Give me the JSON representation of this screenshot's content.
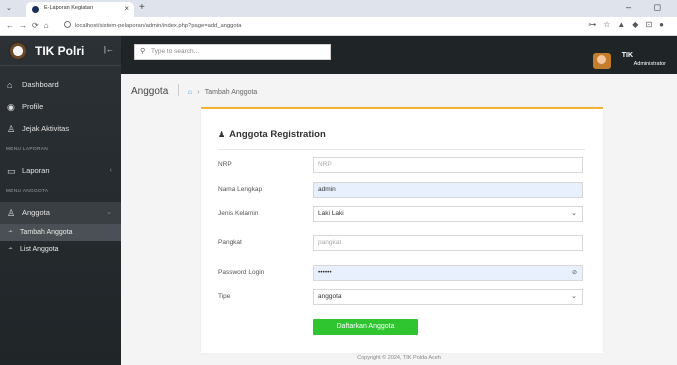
{
  "browser": {
    "tab_title": "E-Laporan Kegiatan",
    "tab_close": "×",
    "new_tab": "+",
    "url": "localhost/sistem-pelaporan/admin/index.php?page=add_anggota",
    "window_controls": "–  ◻",
    "nav": "←→⟳⌂"
  },
  "sidebar": {
    "brand": "TIK Polri",
    "items": [
      {
        "label": "Dashboard",
        "icon": "home-icon"
      },
      {
        "label": "Profile",
        "icon": "user-circle-icon"
      },
      {
        "label": "Jejak Aktivitas",
        "icon": "users-icon"
      }
    ],
    "header_laporan": "MENU LAPORAN",
    "laporan": {
      "label": "Laporan",
      "caret": "‹"
    },
    "header_anggota": "MENU ANGGOTA",
    "anggota": {
      "label": "Anggota",
      "caret": "⌄"
    },
    "sub_items": [
      {
        "label": "Tambah Anggota"
      },
      {
        "label": "List Anggota"
      }
    ]
  },
  "topbar": {
    "search_placeholder": "Type to search...",
    "user_name": "TIK",
    "user_role": "Administrator"
  },
  "page": {
    "title": "Anggota",
    "breadcrumb_current": "Tambah Anggota"
  },
  "form": {
    "title": "Anggota Registration",
    "fields": {
      "nrp": {
        "label": "NRP",
        "placeholder": "NRP"
      },
      "nama": {
        "label": "Nama Lengkap",
        "value": "admin"
      },
      "jenis_kelamin": {
        "label": "Jenis Kelamin",
        "value": "Laki Laki"
      },
      "pangkat": {
        "label": "Pangkat",
        "placeholder": "pangkat"
      },
      "password": {
        "label": "Password Login",
        "value": "••••••"
      },
      "tipe": {
        "label": "Tipe",
        "value": "anggota"
      }
    },
    "submit_label": "Daftarkan Anggota"
  },
  "footer": {
    "text": "Copyright © 2024, TIK Polda Aceh"
  }
}
